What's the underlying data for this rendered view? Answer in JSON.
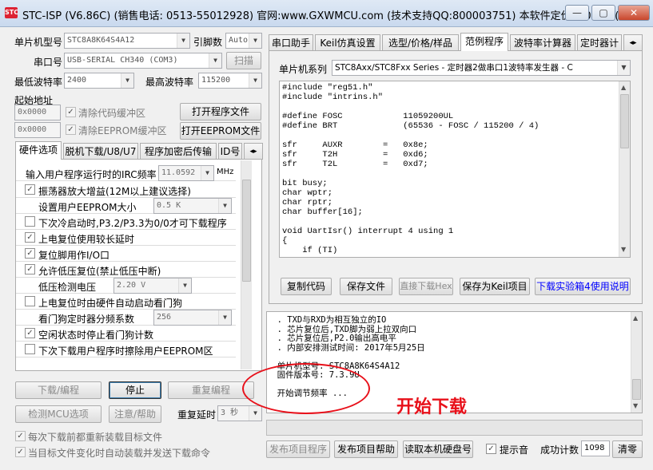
{
  "window": {
    "title": "STC-ISP (V6.86C) (销售电话: 0513-55012928) 官网:www.GXWMCU.com  (技术支持QQ:800003751) 本软件定价: 6000元(...",
    "icon": "stc-app-icon",
    "min": "—",
    "max": "▢",
    "close": "✕"
  },
  "mcu": {
    "label": "单片机型号",
    "value": "STC8A8K64S4A12",
    "pin_label": "引脚数",
    "pin_value": "Auto"
  },
  "port": {
    "label": "串口号",
    "value": "USB-SERIAL CH340 (COM3)",
    "scan": "扫描"
  },
  "baud": {
    "min_label": "最低波特率",
    "min_value": "2400",
    "max_label": "最高波特率",
    "max_value": "115200"
  },
  "addr": {
    "label": "起始地址",
    "code_addr": "0x0000",
    "clear_code": "清除代码缓冲区",
    "open_prog": "打开程序文件",
    "eeprom_addr": "0x0000",
    "clear_eeprom": "清除EEPROM缓冲区",
    "open_eeprom": "打开EEPROM文件"
  },
  "left_tabs": [
    "硬件选项",
    "脱机下载/U8/U7",
    "程序加密后传输",
    "ID号"
  ],
  "options": {
    "irc_label": "输入用户程序运行时的IRC频率",
    "irc_value": "11.0592",
    "irc_unit": "MHz",
    "osc_amp": "振荡器放大增益(12M以上建议选择)",
    "eeprom_label": "设置用户EEPROM大小",
    "eeprom_value": "0.5 K",
    "cold_boot": "下次冷启动时,P3.2/P3.3为0/0才可下载程序",
    "long_reset": "上电复位使用较长延时",
    "reset_io": "复位脚用作I/O口",
    "low_volt_reset": "允许低压复位(禁止低压中断)",
    "low_volt_label": "低压检测电压",
    "low_volt_value": "2.20 V",
    "watchdog_auto": "上电复位时由硬件自动启动看门狗",
    "wdt_div_label": "看门狗定时器分频系数",
    "wdt_div_value": "256",
    "idle_wdt": "空闲状态时停止看门狗计数",
    "erase_eeprom": "下次下载用户程序时擦除用户EEPROM区"
  },
  "actions": {
    "download": "下载/编程",
    "stop": "停止",
    "reprogram": "重复编程",
    "check_mcu": "检测MCU选项",
    "help": "注意/帮助",
    "retry_label": "重复延时",
    "retry_value": "3 秒",
    "reload_each": "每次下载前都重新装载目标文件",
    "auto_reload": "当目标文件变化时自动装载并发送下载命令"
  },
  "right_tabs": [
    "串口助手",
    "Keil仿真设置",
    "选型/价格/样品",
    "范例程序",
    "波特率计算器",
    "定时器计"
  ],
  "example": {
    "series_label": "单片机系列",
    "series_value": "STC8Axx/STC8Fxx Series - 定时器2做串口1波特率发生器 - C",
    "code_lines": [
      "#include \"reg51.h\"",
      "#include \"intrins.h\"",
      "",
      "#define FOSC            11059200UL",
      "#define BRT             (65536 - FOSC / 115200 / 4)",
      "",
      "sfr     AUXR        =   0x8e;",
      "sfr     T2H         =   0xd6;",
      "sfr     T2L         =   0xd7;",
      "",
      "bit busy;",
      "char wptr;",
      "char rptr;",
      "char buffer[16];",
      "",
      "void UartIsr() interrupt 4 using 1",
      "{",
      "    if (TI)"
    ],
    "copy": "复制代码",
    "save": "保存文件",
    "direct_dl": "直接下载Hex",
    "save_keil": "保存为Keil项目",
    "kit_link": "下载实验箱4使用说明"
  },
  "log": {
    "lines": [
      "  . TXD与RXD为相互独立的IO",
      "  . 芯片复位后,TXD脚为弱上拉双向口",
      "  . 芯片复位后,P2.0输出高电平",
      "  . 内部安排测试时间: 2017年5月25日",
      "",
      "  单片机型号: STC8A8K64S4A12",
      "  固件版本号: 7.3.9U",
      "",
      "  开始调节频率 ..."
    ],
    "annotation": "开始下载"
  },
  "bottom": {
    "publish": "发布项目程序",
    "publish_help": "发布项目帮助",
    "read_disk": "读取本机硬盘号",
    "sound": "提示音",
    "success_label": "成功计数",
    "success_count": "1098",
    "clear": "清零"
  },
  "colors": {
    "accent": "#0055cc",
    "annotation": "#e8101a",
    "link": "#0000ff"
  }
}
